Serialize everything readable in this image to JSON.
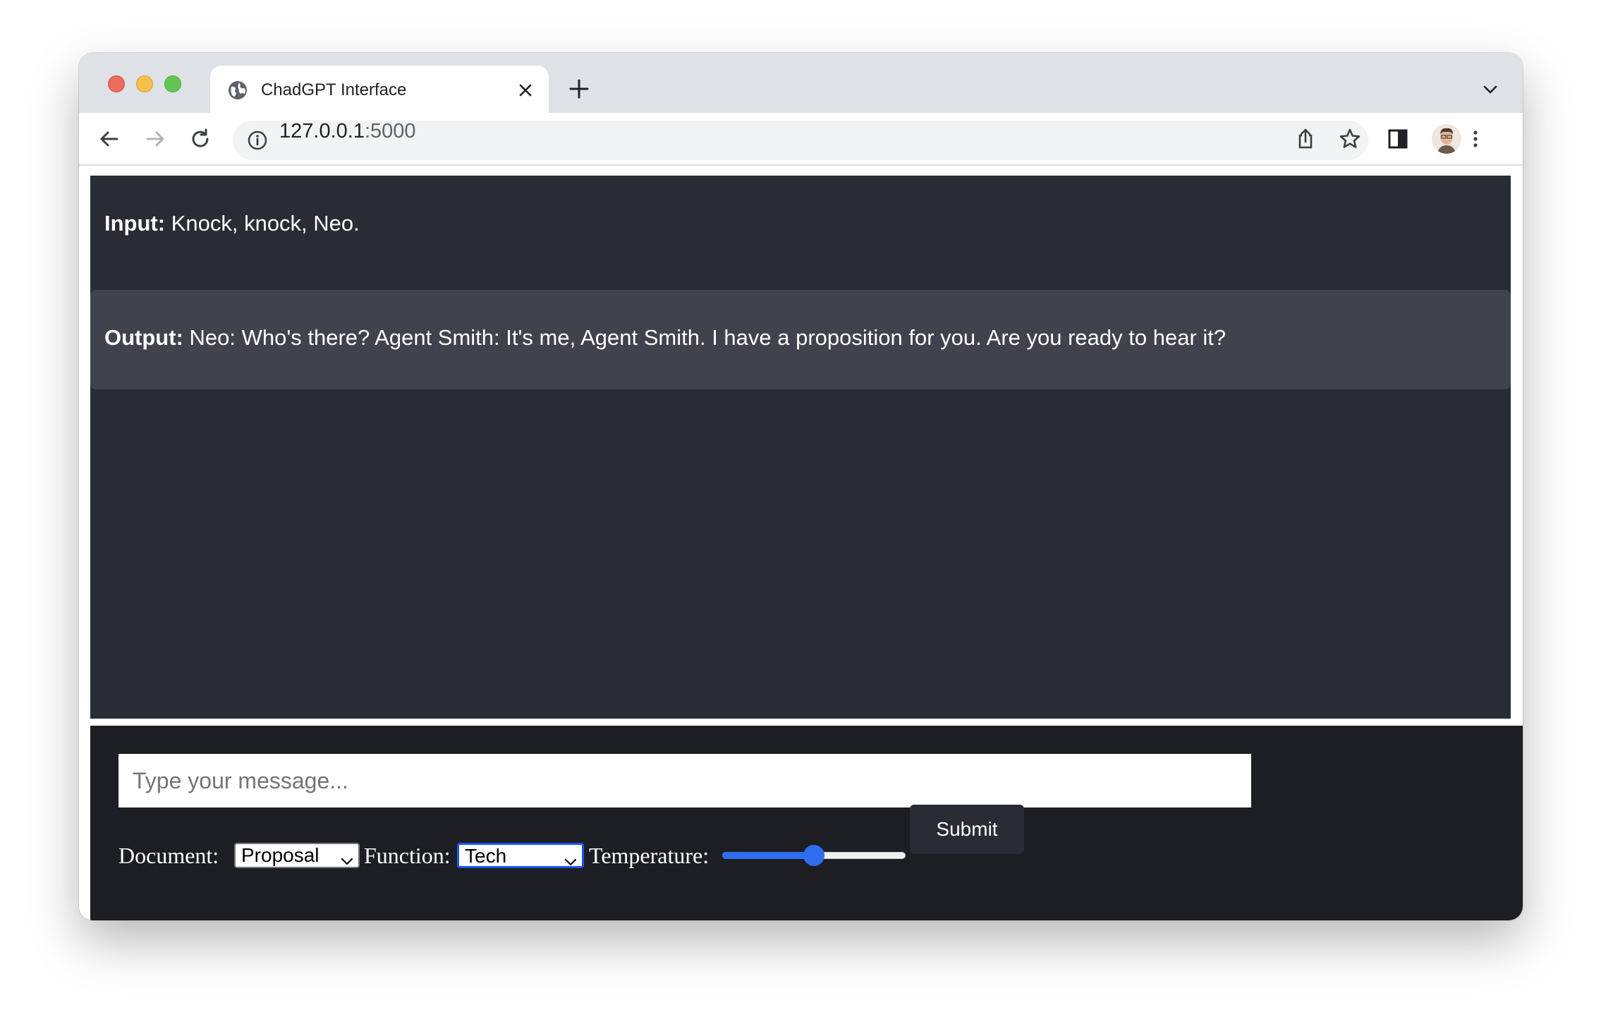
{
  "browser": {
    "tab_title": "ChadGPT Interface",
    "url_host": "127.0.0.1",
    "url_port": ":5000"
  },
  "chat": {
    "input_label": "Input:",
    "input_text": " Knock, knock, Neo.",
    "output_label": "Output:",
    "output_text": " Neo: Who's there? Agent Smith: It's me, Agent Smith. I have a proposition for you. Are you ready to hear it?"
  },
  "controls": {
    "message_placeholder": "Type your message...",
    "document_label": "Document:",
    "document_value": "Proposal",
    "function_label": "Function:",
    "function_value": "Tech",
    "temperature_label": "Temperature:",
    "temperature_value": 0.5,
    "submit_label": "Submit"
  },
  "colors": {
    "chat_bg": "#2a2c35",
    "output_bg": "#40424d",
    "controls_bg": "#1d1e23",
    "accent": "#2f6ef0"
  },
  "icons": [
    "globe-icon",
    "close-icon",
    "plus-icon",
    "chevron-down-icon",
    "back-arrow-icon",
    "forward-arrow-icon",
    "reload-icon",
    "info-icon",
    "share-icon",
    "star-icon",
    "side-panel-icon",
    "kebab-menu-icon"
  ]
}
